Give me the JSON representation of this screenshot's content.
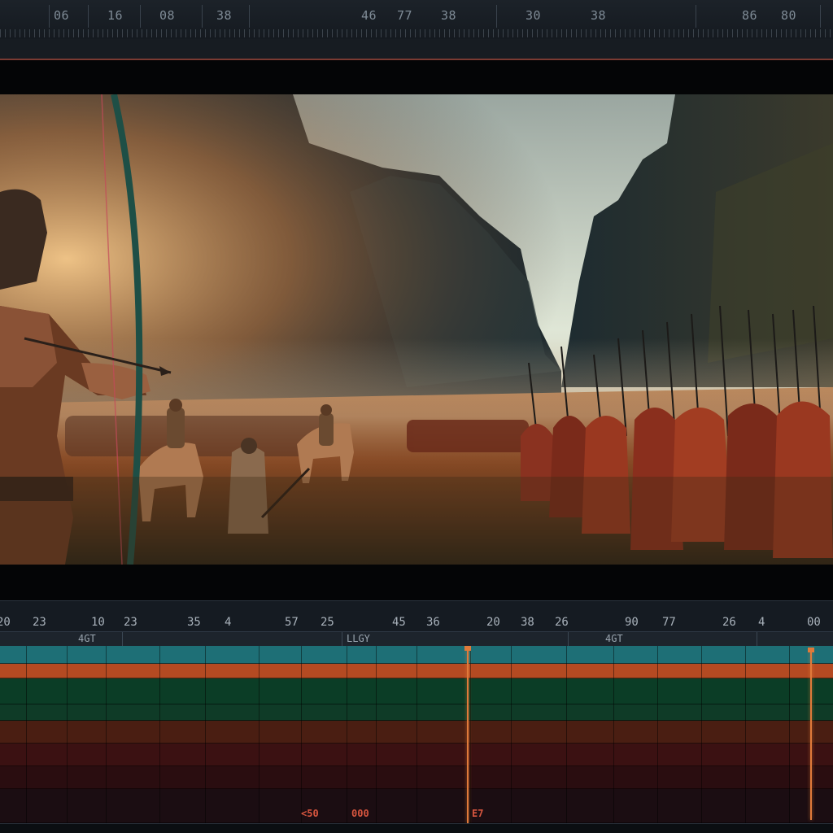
{
  "top_ruler": {
    "numbers": [
      "06",
      "16",
      "08",
      "38",
      "46",
      "77",
      "38",
      "30",
      "38",
      "86",
      "80"
    ]
  },
  "viewer": {
    "frame_label": "Video preview"
  },
  "timeline": {
    "ruler_numbers": [
      "20",
      "23",
      "10",
      "23",
      "35",
      "4",
      "57",
      "25",
      "45",
      "36",
      "20",
      "38",
      "26",
      "90",
      "77",
      "26",
      "4",
      "00"
    ],
    "header_labels": [
      "4GT",
      "LLGY",
      "4GT"
    ],
    "tracks": [
      {
        "name": "track-teal",
        "color": "#1e6f76"
      },
      {
        "name": "track-orange",
        "color": "#b44a22"
      },
      {
        "name": "track-green-1",
        "color": "#0b3d26"
      },
      {
        "name": "track-green-2",
        "color": "#0f3b27"
      },
      {
        "name": "track-brown",
        "color": "#4a1e12"
      },
      {
        "name": "track-maroon-1",
        "color": "#3b1112"
      },
      {
        "name": "track-maroon-2",
        "color": "#2a0d10"
      },
      {
        "name": "track-dark",
        "color": "#1b0d12"
      }
    ],
    "markers": [
      "<50",
      "000",
      "E7"
    ]
  },
  "colors": {
    "accent": "#e07a3a",
    "marker": "#d8563f"
  }
}
